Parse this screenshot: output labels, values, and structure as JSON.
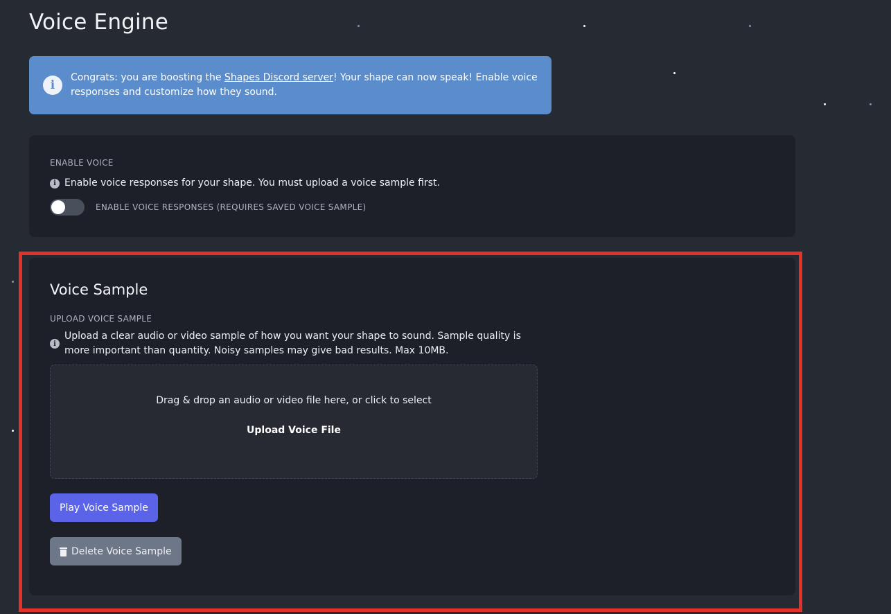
{
  "page": {
    "title": "Voice Engine"
  },
  "banner": {
    "icon": "info-icon",
    "text_before": "Congrats: you are boosting the ",
    "link_text": "Shapes Discord server",
    "text_after": "! Your shape can now speak! Enable voice responses and customize how they sound.",
    "color": "#5b8ccb"
  },
  "enable_voice": {
    "section_label": "ENABLE VOICE",
    "hint_icon": "info-icon",
    "hint": "Enable voice responses for your shape. You must upload a voice sample first.",
    "toggle_label": "ENABLE VOICE RESPONSES (REQUIRES SAVED VOICE SAMPLE)",
    "toggle_on": false
  },
  "voice_sample": {
    "title": "Voice Sample",
    "section_label": "UPLOAD VOICE SAMPLE",
    "hint_icon": "info-icon",
    "hint": "Upload a clear audio or video sample of how you want your shape to sound. Sample quality is more important than quantity. Noisy samples may give bad results. Max 10MB.",
    "dropzone_text": "Drag & drop an audio or video file here, or click to select",
    "upload_button_label": "Upload Voice File",
    "play_button_label": "Play Voice Sample",
    "delete_button_icon": "trash-icon",
    "delete_button_label": "Delete Voice Sample",
    "play_button_color": "#5b63e8",
    "delete_button_color": "#6d7787"
  },
  "highlight": {
    "color": "#e2322a"
  }
}
